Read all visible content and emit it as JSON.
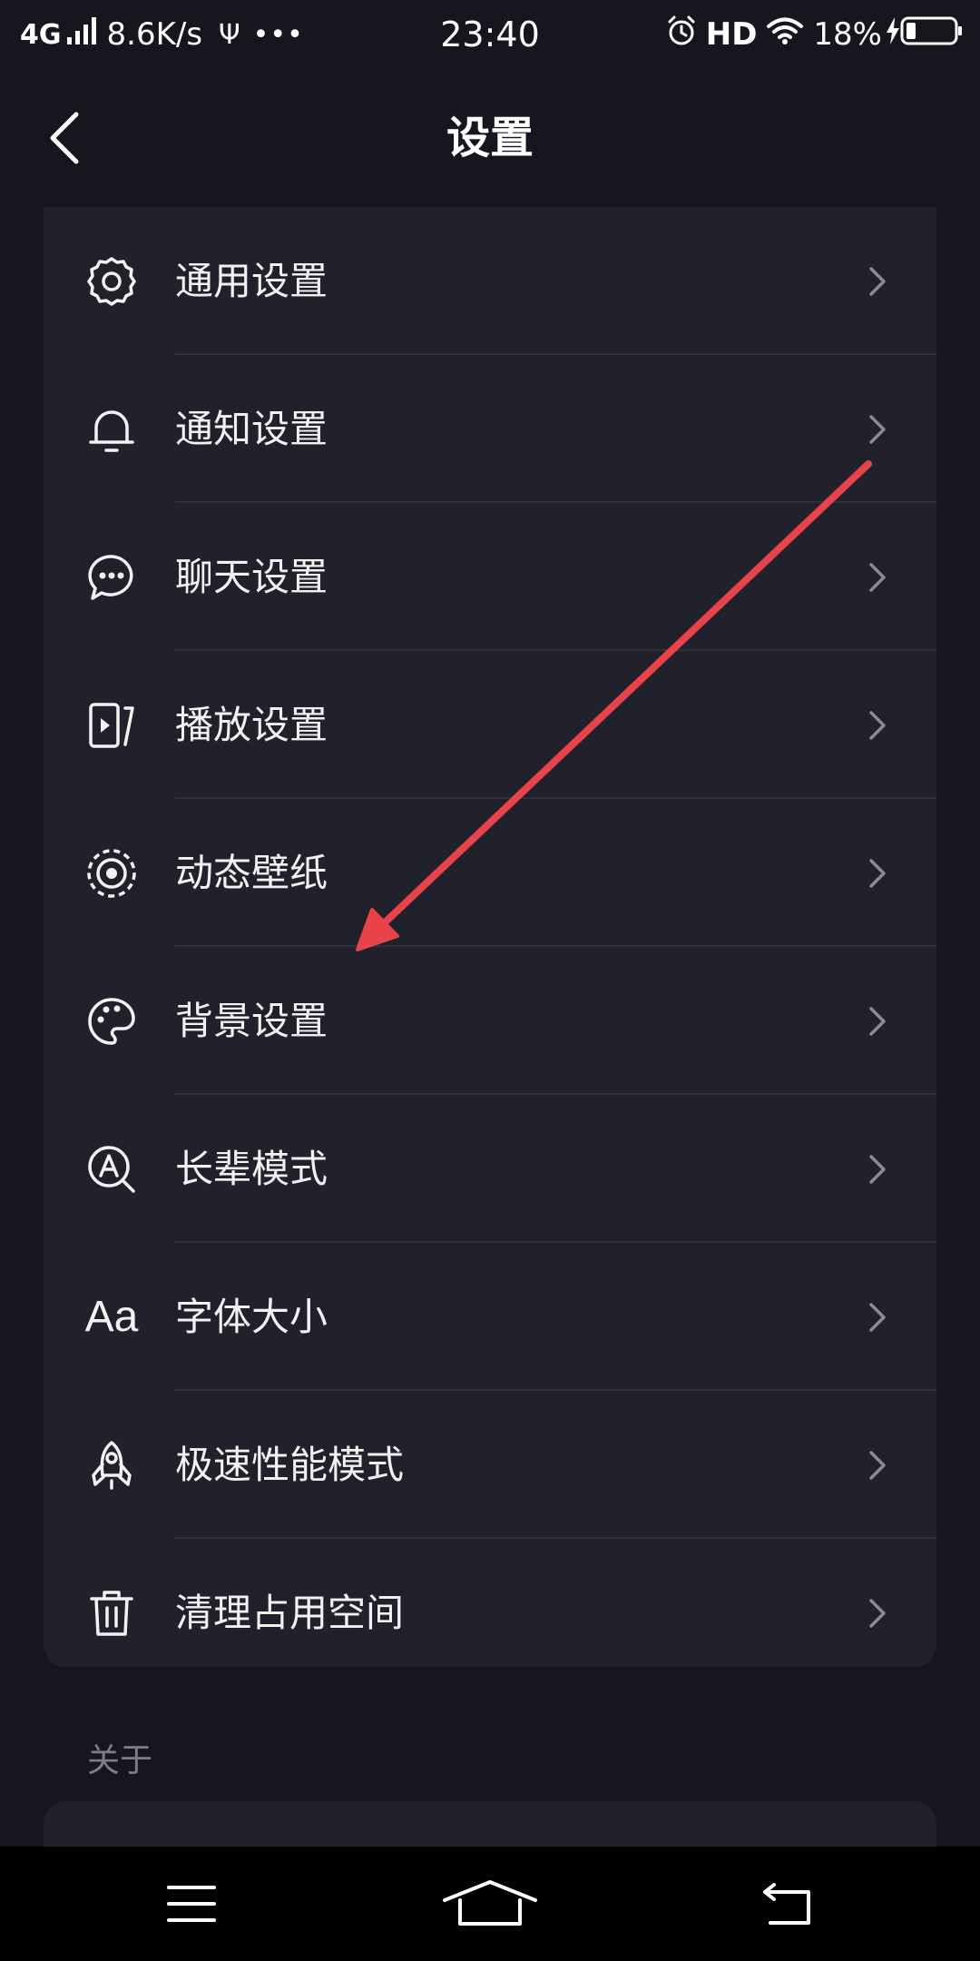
{
  "status_bar": {
    "network": "4G",
    "speed": "8.6K/s",
    "time": "23:40",
    "hd": "HD",
    "battery": "18%"
  },
  "header": {
    "title": "设置"
  },
  "settings": {
    "items": [
      {
        "label": "通用设置",
        "icon": "gear-icon"
      },
      {
        "label": "通知设置",
        "icon": "bell-icon"
      },
      {
        "label": "聊天设置",
        "icon": "chat-bubble-icon"
      },
      {
        "label": "播放设置",
        "icon": "play-screen-icon"
      },
      {
        "label": "动态壁纸",
        "icon": "live-wallpaper-icon"
      },
      {
        "label": "背景设置",
        "icon": "palette-icon"
      },
      {
        "label": "长辈模式",
        "icon": "magnifier-a-icon"
      },
      {
        "label": "字体大小",
        "icon": "font-size-icon",
        "icon_text": "Aa"
      },
      {
        "label": "极速性能模式",
        "icon": "rocket-icon"
      },
      {
        "label": "清理占用空间",
        "icon": "trash-icon"
      }
    ]
  },
  "about": {
    "section_title": "关于"
  },
  "colors": {
    "background": "#16161e",
    "card": "#21212b",
    "text": "#f2f2f2",
    "muted": "#7d7d86",
    "chevron": "#8a8a93",
    "annotation_arrow": "#e8424a"
  }
}
